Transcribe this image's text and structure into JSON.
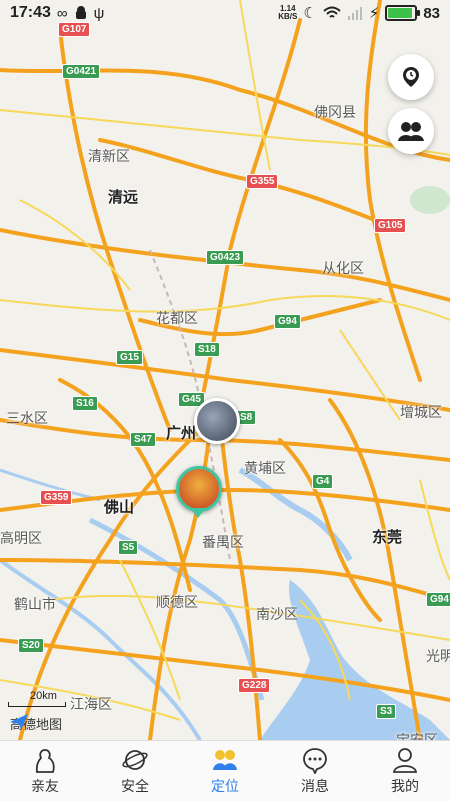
{
  "status": {
    "time": "17:43",
    "speed_value": "1.14",
    "speed_unit": "KB/S",
    "battery": "83",
    "battery_level": 0.83
  },
  "map": {
    "places": [
      {
        "name": "清新区",
        "major": false
      },
      {
        "name": "清远",
        "major": true
      },
      {
        "name": "佛冈县",
        "major": false
      },
      {
        "name": "从化区",
        "major": false
      },
      {
        "name": "花都区",
        "major": false
      },
      {
        "name": "三水区",
        "major": false
      },
      {
        "name": "广州",
        "major": true
      },
      {
        "name": "黄埔区",
        "major": false
      },
      {
        "name": "增城区",
        "major": false
      },
      {
        "name": "佛山",
        "major": true
      },
      {
        "name": "高明区",
        "major": false
      },
      {
        "name": "番禺区",
        "major": false
      },
      {
        "name": "东莞",
        "major": true
      },
      {
        "name": "鹤山市",
        "major": false
      },
      {
        "name": "顺德区",
        "major": false
      },
      {
        "name": "南沙区",
        "major": false
      },
      {
        "name": "江海区",
        "major": false
      },
      {
        "name": "光明",
        "major": false
      },
      {
        "name": "宝安区",
        "major": false
      }
    ],
    "roads": [
      {
        "name": "G107",
        "color": "red"
      },
      {
        "name": "G0421",
        "color": "green"
      },
      {
        "name": "G355",
        "color": "red"
      },
      {
        "name": "G105",
        "color": "red"
      },
      {
        "name": "G0423",
        "color": "green"
      },
      {
        "name": "G94",
        "color": "green"
      },
      {
        "name": "S18",
        "color": "green"
      },
      {
        "name": "G15",
        "color": "green"
      },
      {
        "name": "G45",
        "color": "green"
      },
      {
        "name": "S8",
        "color": "green"
      },
      {
        "name": "S16",
        "color": "green"
      },
      {
        "name": "S47",
        "color": "green"
      },
      {
        "name": "G4",
        "color": "green"
      },
      {
        "name": "G359",
        "color": "red"
      },
      {
        "name": "S5",
        "color": "green"
      },
      {
        "name": "S20",
        "color": "green"
      },
      {
        "name": "G228",
        "color": "red"
      },
      {
        "name": "G94",
        "color": "green"
      },
      {
        "name": "S3",
        "color": "green"
      }
    ],
    "scale_label": "20km",
    "provider_logo": "高德地图"
  },
  "tabs": [
    {
      "label": "亲友",
      "icon": "family-icon",
      "active": false
    },
    {
      "label": "安全",
      "icon": "planet-icon",
      "active": false
    },
    {
      "label": "定位",
      "icon": "location-group-icon",
      "active": true
    },
    {
      "label": "消息",
      "icon": "message-icon",
      "active": false
    },
    {
      "label": "我的",
      "icon": "profile-icon",
      "active": false
    }
  ],
  "colors": {
    "accent": "#2f80ed",
    "highway": "#f4a21e",
    "water": "#a8cdf0"
  }
}
